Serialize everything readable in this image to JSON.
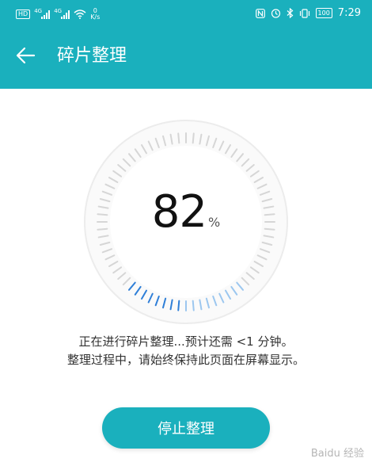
{
  "status_bar": {
    "hd_label": "HD",
    "net1": "4G",
    "net2": "4G",
    "speed_value": "0",
    "speed_unit": "K/s",
    "battery": "100",
    "time": "7:29"
  },
  "header": {
    "title": "碎片整理",
    "background_color": "#1ab0bd"
  },
  "progress": {
    "value": 82,
    "value_text": "82",
    "unit": "%"
  },
  "messages": {
    "line1": "正在进行碎片整理...预计还需 <1 分钟。",
    "line2": "整理过程中，请始终保持此页面在屏幕显示。"
  },
  "stop_button": {
    "label": "停止整理",
    "color": "#1ab0bd"
  },
  "watermark": {
    "text": "Baidu 经验"
  },
  "icons": [
    "back-arrow-icon",
    "nfc-icon",
    "alarm-icon",
    "bluetooth-icon",
    "vibrate-icon",
    "wifi-icon",
    "signal-icon"
  ]
}
